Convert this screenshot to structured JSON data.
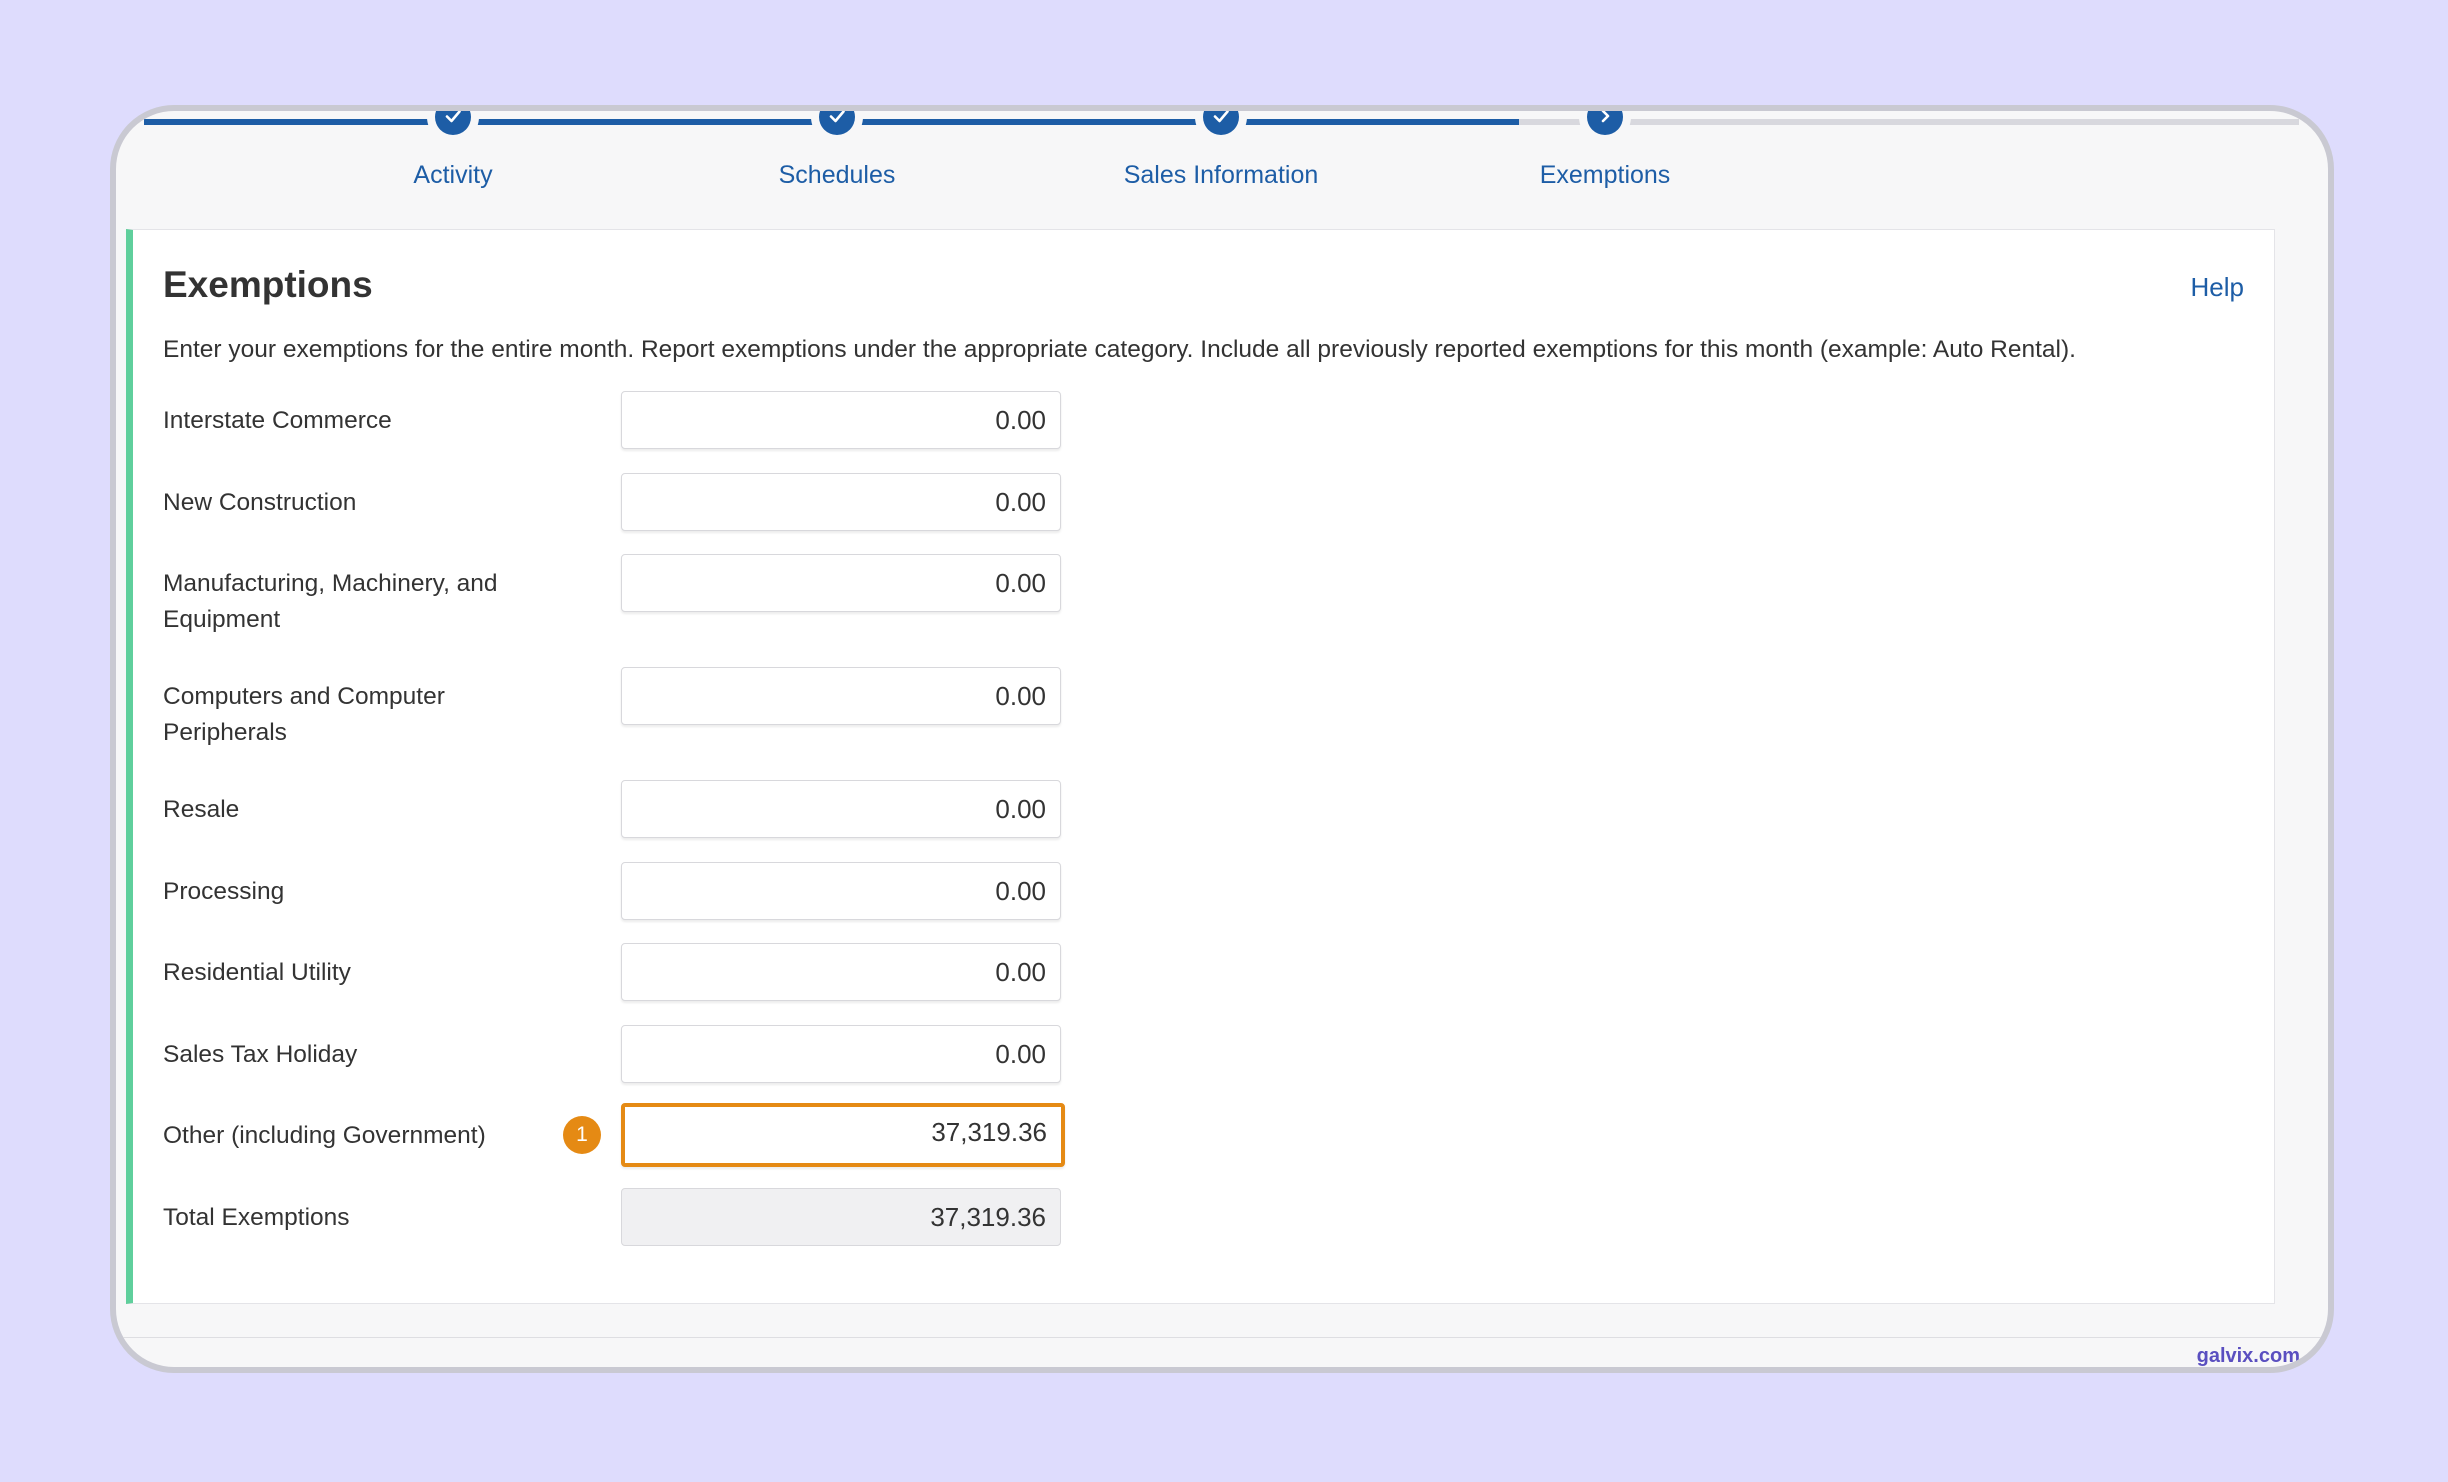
{
  "stepper": {
    "steps": [
      {
        "label": "Activity",
        "state": "complete"
      },
      {
        "label": "Schedules",
        "state": "complete"
      },
      {
        "label": "Sales Information",
        "state": "complete"
      },
      {
        "label": "Exemptions",
        "state": "current"
      }
    ]
  },
  "section": {
    "title": "Exemptions",
    "help_label": "Help",
    "intro": "Enter your exemptions for the entire month. Report exemptions under the appropriate category. Include all previously reported exemptions for this month (example: Auto Rental)."
  },
  "fields": [
    {
      "label": "Interstate Commerce",
      "value": "0.00"
    },
    {
      "label": "New Construction",
      "value": "0.00"
    },
    {
      "label": "Manufacturing, Machinery, and Equipment",
      "value": "0.00"
    },
    {
      "label": "Computers and Computer Peripherals",
      "value": "0.00"
    },
    {
      "label": "Resale",
      "value": "0.00"
    },
    {
      "label": "Processing",
      "value": "0.00"
    },
    {
      "label": "Residential Utility",
      "value": "0.00"
    },
    {
      "label": "Sales Tax Holiday",
      "value": "0.00"
    },
    {
      "label": "Other (including Government)",
      "value": "37,319.36",
      "badge": "1"
    }
  ],
  "total": {
    "label": "Total Exemptions",
    "value": "37,319.36"
  },
  "watermark": "galvix.com",
  "colors": {
    "primary": "#1d5da6",
    "highlight": "#e58a14",
    "accent_bar": "#5fcf9c",
    "background": "#dedcfd"
  }
}
